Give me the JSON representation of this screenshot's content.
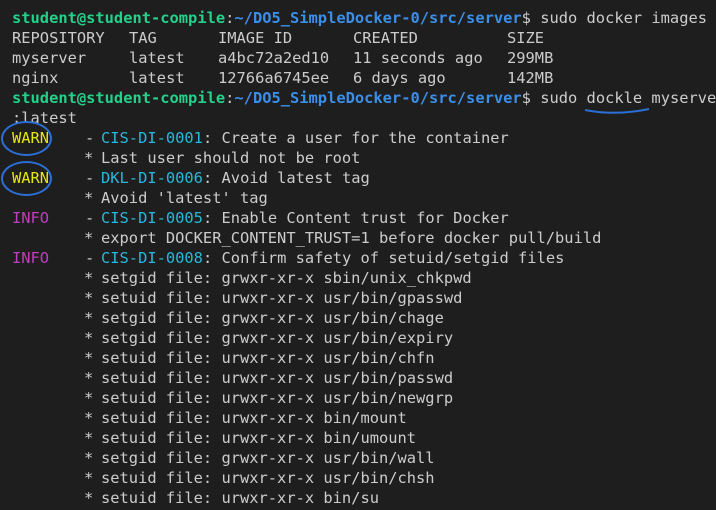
{
  "prompt": {
    "user": "student@student-compile",
    "path": "~/DO5_SimpleDocker-0/src/server"
  },
  "commands": {
    "images": "sudo docker images",
    "dockle_prefix": "sudo ",
    "dockle_tool": "dockle",
    "dockle_args": " myserver",
    "dockle_wrap": ":latest"
  },
  "images_table": {
    "headers": [
      "REPOSITORY",
      "TAG",
      "IMAGE ID",
      "CREATED",
      "SIZE"
    ],
    "rows": [
      [
        "myserver",
        "latest",
        "a4bc72a2ed10",
        "11 seconds ago",
        "299MB"
      ],
      [
        "nginx",
        "latest",
        "12766a6745ee",
        "6 days ago",
        "142MB"
      ]
    ]
  },
  "dockle_results": [
    {
      "level": "WARN",
      "level_color": "#e5e510",
      "id": "CIS-DI-0001",
      "title": "Create a user for the container",
      "details": [
        "Last user should not be root"
      ],
      "circled": true
    },
    {
      "level": "WARN",
      "level_color": "#e5e510",
      "id": "DKL-DI-0006",
      "title": "Avoid latest tag",
      "details": [
        "Avoid 'latest' tag"
      ],
      "circled": true
    },
    {
      "level": "INFO",
      "level_color": "#bc3fbc",
      "id": "CIS-DI-0005",
      "title": "Enable Content trust for Docker",
      "details": [
        "export DOCKER_CONTENT_TRUST=1 before docker pull/build"
      ],
      "circled": false
    },
    {
      "level": "INFO",
      "level_color": "#bc3fbc",
      "id": "CIS-DI-0008",
      "title": "Confirm safety of setuid/setgid files",
      "details": [
        "setgid file: grwxr-xr-x sbin/unix_chkpwd",
        "setuid file: urwxr-xr-x usr/bin/gpasswd",
        "setgid file: grwxr-xr-x usr/bin/chage",
        "setgid file: grwxr-xr-x usr/bin/expiry",
        "setuid file: urwxr-xr-x usr/bin/chfn",
        "setuid file: urwxr-xr-x usr/bin/passwd",
        "setuid file: urwxr-xr-x usr/bin/newgrp",
        "setuid file: urwxr-xr-x bin/mount",
        "setuid file: urwxr-xr-x bin/umount",
        "setgid file: grwxr-xr-x usr/bin/wall",
        "setuid file: urwxr-xr-x usr/bin/chsh",
        "setuid file: urwxr-xr-x bin/su"
      ],
      "circled": false
    }
  ],
  "colors": {
    "background": "#1e1e1e",
    "text": "#cccccc",
    "prompt_user": "#23d18b",
    "prompt_path": "#3b8eea",
    "rule_id": "#29b8db",
    "annotation": "#2b6fd6"
  }
}
